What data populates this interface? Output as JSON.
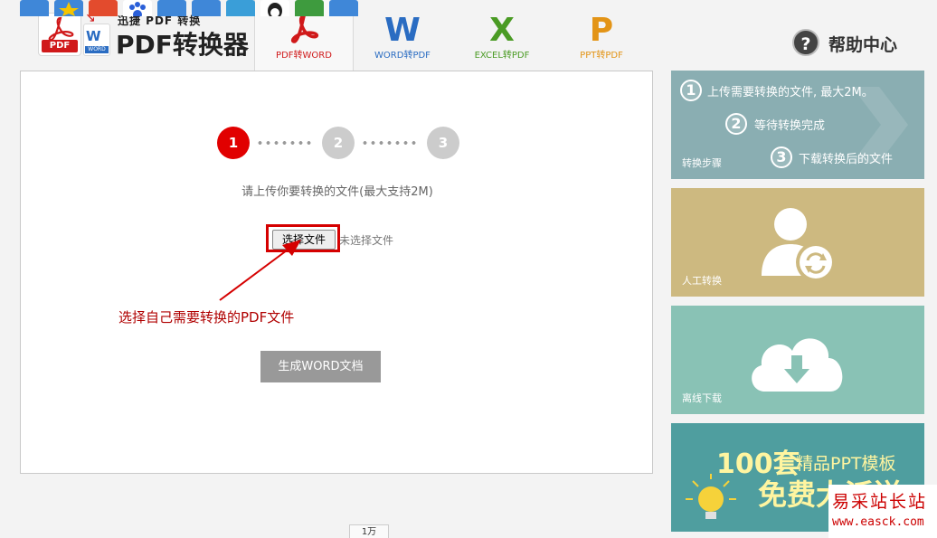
{
  "header": {
    "logo_small": "迅捷 PDF 转换",
    "logo_big": "PDF转换器",
    "logo_icon_pdf_text": "PDF",
    "logo_icon_word_text": "WORD",
    "tabs": [
      {
        "label": "PDF转WORD",
        "glyph": "",
        "color": "#d0191a",
        "active": true
      },
      {
        "label": "WORD转PDF",
        "glyph": "W",
        "color": "#2a6cc2",
        "active": false
      },
      {
        "label": "EXCEL转PDF",
        "glyph": "X",
        "color": "#4a9b24",
        "active": false
      },
      {
        "label": "PPT转PDF",
        "glyph": "P",
        "color": "#e39416",
        "active": false
      }
    ],
    "help_label": "帮助中心"
  },
  "main": {
    "steps": [
      "1",
      "2",
      "3"
    ],
    "active_step": "1",
    "instruction": "请上传你要转换的文件(最大支持2M)",
    "choose_file_label": "选择文件",
    "no_file_label": "未选择文件",
    "annotation": "选择自己需要转换的PDF文件",
    "generate_label": "生成WORD文档"
  },
  "sidebar": {
    "steps_panel": {
      "step1": "上传需要转换的文件, 最大2M。",
      "step2": "等待转换完成",
      "step3": "下载转换后的文件",
      "caption": "转换步骤"
    },
    "manual_caption": "人工转换",
    "offline_caption": "离线下载",
    "promo": {
      "big": "100套",
      "sub": "精品PPT模板",
      "big2": "免费大派送"
    }
  },
  "watermark": {
    "line1": "易采站长站",
    "line2": "www.easck.com"
  },
  "share": {
    "count": "1万",
    "icons": [
      "share-icon-1",
      "share-icon-qzone",
      "share-icon-weibo",
      "share-icon-baidu",
      "share-icon-bookmark",
      "share-icon-renren",
      "share-icon-kaixin",
      "share-icon-qq",
      "share-icon-douban",
      "share-icon-more"
    ]
  },
  "colors": {
    "accent_red": "#d50000",
    "step_active": "#e10000",
    "step_inactive": "#cccccc"
  }
}
